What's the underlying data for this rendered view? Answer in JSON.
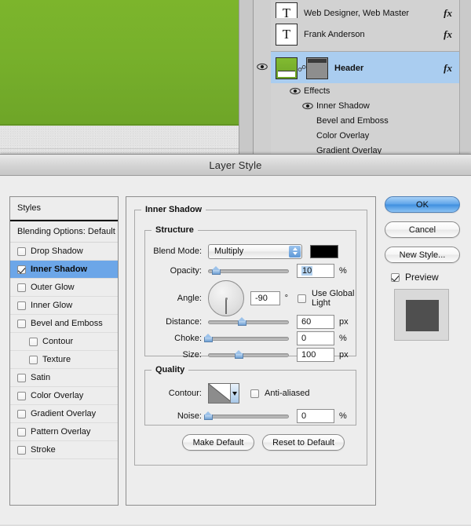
{
  "app": {
    "layers_panel": {
      "layers": [
        {
          "name": "Web Designer, Web Master",
          "thumb": "type",
          "fx": "fx",
          "tri": "▼",
          "selected": false,
          "eye": false
        },
        {
          "name": "Frank Anderson",
          "thumb": "type",
          "fx": "fx",
          "tri": "▼",
          "selected": false,
          "eye": false
        },
        {
          "name": "Header",
          "thumb": "green-mask",
          "fx": "fx",
          "tri": "▲",
          "selected": true,
          "eye": true
        }
      ],
      "effects": [
        {
          "label": "Effects",
          "eye": true,
          "indent": 0
        },
        {
          "label": "Inner Shadow",
          "eye": true,
          "indent": 1
        },
        {
          "label": "Bevel and Emboss",
          "eye": false,
          "indent": 1
        },
        {
          "label": "Color Overlay",
          "eye": false,
          "indent": 1
        },
        {
          "label": "Gradient Overlay",
          "eye": false,
          "indent": 1
        }
      ]
    }
  },
  "dialog": {
    "title": "Layer Style",
    "styles": {
      "header": "Styles",
      "blending_options": "Blending Options: Default",
      "items": [
        {
          "label": "Drop Shadow",
          "checked": false,
          "selected": false,
          "indent": false
        },
        {
          "label": "Inner Shadow",
          "checked": true,
          "selected": true,
          "indent": false
        },
        {
          "label": "Outer Glow",
          "checked": false,
          "selected": false,
          "indent": false
        },
        {
          "label": "Inner Glow",
          "checked": false,
          "selected": false,
          "indent": false
        },
        {
          "label": "Bevel and Emboss",
          "checked": false,
          "selected": false,
          "indent": false
        },
        {
          "label": "Contour",
          "checked": false,
          "selected": false,
          "indent": true
        },
        {
          "label": "Texture",
          "checked": false,
          "selected": false,
          "indent": true
        },
        {
          "label": "Satin",
          "checked": false,
          "selected": false,
          "indent": false
        },
        {
          "label": "Color Overlay",
          "checked": false,
          "selected": false,
          "indent": false
        },
        {
          "label": "Gradient Overlay",
          "checked": false,
          "selected": false,
          "indent": false
        },
        {
          "label": "Pattern Overlay",
          "checked": false,
          "selected": false,
          "indent": false
        },
        {
          "label": "Stroke",
          "checked": false,
          "selected": false,
          "indent": false
        }
      ]
    },
    "panel": {
      "group_title": "Inner Shadow",
      "structure": {
        "legend": "Structure",
        "blend_mode_label": "Blend Mode:",
        "blend_mode_value": "Multiply",
        "color_swatch": "#000000",
        "opacity_label": "Opacity:",
        "opacity_value": "10",
        "opacity_unit": "%",
        "opacity_percent": 10,
        "angle_label": "Angle:",
        "angle_value": "-90",
        "angle_unit": "°",
        "angle_degrees": -90,
        "use_global_light": "Use Global Light",
        "use_global_light_checked": false,
        "distance_label": "Distance:",
        "distance_value": "60",
        "distance_unit": "px",
        "distance_percent": 42,
        "choke_label": "Choke:",
        "choke_value": "0",
        "choke_unit": "%",
        "choke_percent": 0,
        "size_label": "Size:",
        "size_value": "100",
        "size_unit": "px",
        "size_percent": 38
      },
      "quality": {
        "legend": "Quality",
        "contour_label": "Contour:",
        "anti_aliased": "Anti-aliased",
        "anti_aliased_checked": false,
        "noise_label": "Noise:",
        "noise_value": "0",
        "noise_unit": "%",
        "noise_percent": 0
      },
      "make_default": "Make Default",
      "reset_to_default": "Reset to Default"
    },
    "buttons": {
      "ok": "OK",
      "cancel": "Cancel",
      "new_style": "New Style...",
      "preview": "Preview",
      "preview_checked": true
    }
  },
  "colors": {
    "accent": "#6ca6e8",
    "canvas_green": "#77b02b",
    "selection": "#aacdf0"
  }
}
